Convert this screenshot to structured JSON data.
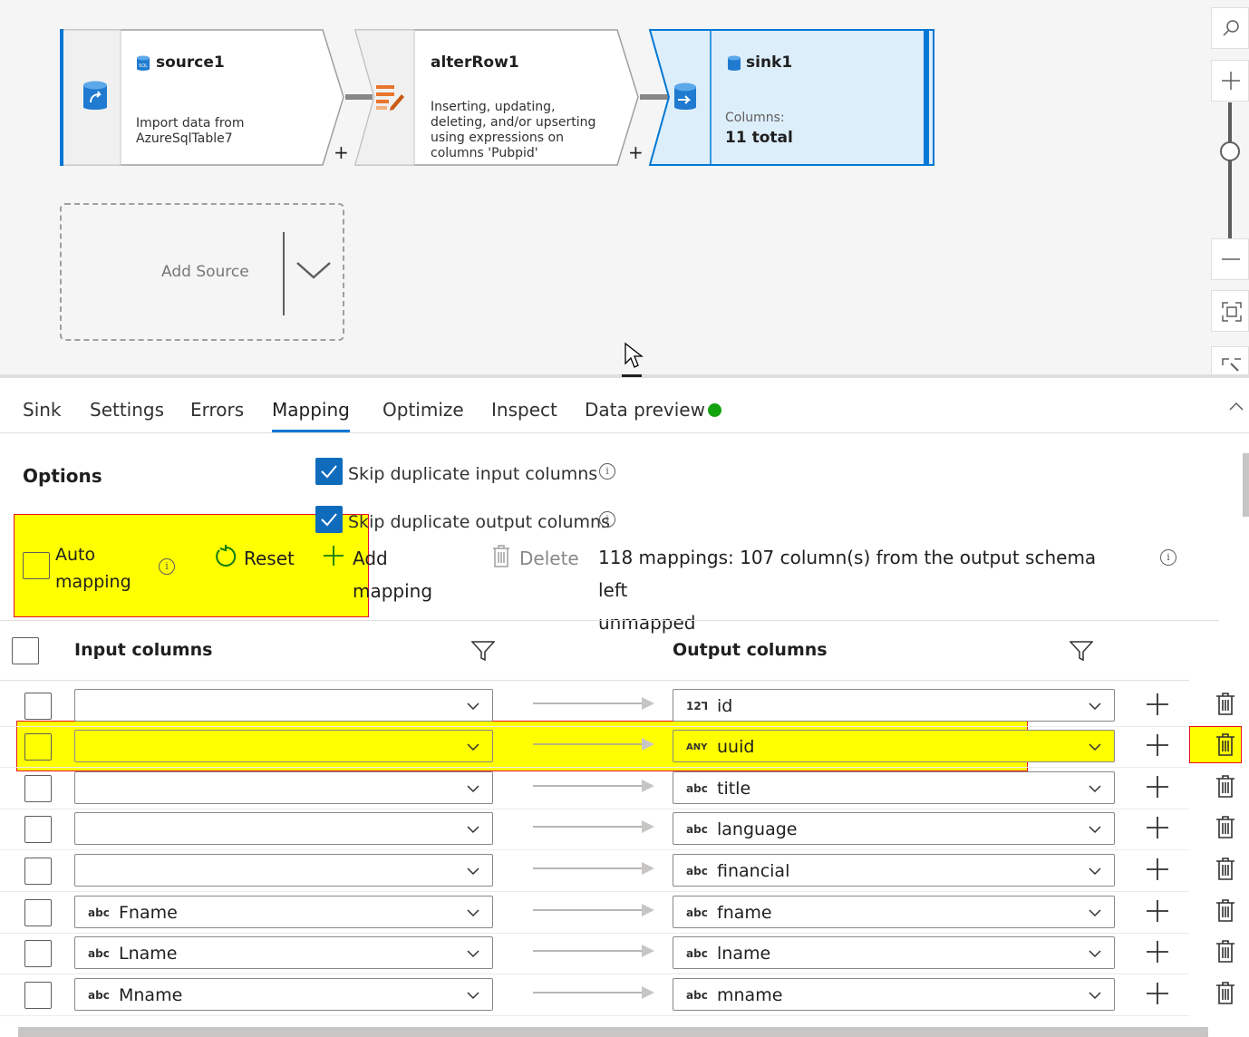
{
  "flow": {
    "nodes": [
      {
        "title": "source1",
        "description": "Import data from AzureSqlTable7",
        "icon": "sql-database-icon"
      },
      {
        "title": "alterRow1",
        "description": "Inserting, updating, deleting, and/or upserting using expressions on columns 'Pubpid'",
        "icon": "alter-row-icon"
      },
      {
        "title": "sink1",
        "columns_label": "Columns:",
        "columns_value": "11 total",
        "icon": "sql-database-icon"
      }
    ],
    "add_plus": "+",
    "add_source_label": "Add Source"
  },
  "zoom": {
    "icons": [
      "search-icon",
      "zoom-in-icon",
      "zoom-out-icon",
      "fit-to-screen-icon",
      "auto-align-icon"
    ],
    "level": 0.6
  },
  "tabs": {
    "items": [
      "Sink",
      "Settings",
      "Errors",
      "Mapping",
      "Optimize",
      "Inspect",
      "Data preview"
    ],
    "active": "Mapping",
    "status_color": "#13a10e"
  },
  "options": {
    "title": "Options",
    "skip_input": "Skip duplicate input columns",
    "skip_output": "Skip duplicate output columns",
    "auto_mapping_line1": "Auto",
    "auto_mapping_line2": "mapping",
    "reset": "Reset",
    "add_mapping_line1": "Add",
    "add_mapping_line2": "mapping",
    "delete": "Delete",
    "summary_line1": "118 mappings: 107 column(s) from the output schema left",
    "summary_line2": "unmapped",
    "info_glyph": "i"
  },
  "grid": {
    "input_header": "Input columns",
    "output_header": "Output columns",
    "rows": [
      {
        "in_type": "",
        "in_value": "",
        "out_type": "12⅂",
        "out_value": "id"
      },
      {
        "in_type": "",
        "in_value": "",
        "out_type": "ANY",
        "out_value": "uuid"
      },
      {
        "in_type": "",
        "in_value": "",
        "out_type": "abc",
        "out_value": "title"
      },
      {
        "in_type": "",
        "in_value": "",
        "out_type": "abc",
        "out_value": "language"
      },
      {
        "in_type": "",
        "in_value": "",
        "out_type": "abc",
        "out_value": "financial"
      },
      {
        "in_type": "abc",
        "in_value": "Fname",
        "out_type": "abc",
        "out_value": "fname"
      },
      {
        "in_type": "abc",
        "in_value": "Lname",
        "out_type": "abc",
        "out_value": "lname"
      },
      {
        "in_type": "abc",
        "in_value": "Mname",
        "out_type": "abc",
        "out_value": "mname"
      }
    ]
  },
  "colors": {
    "accent": "#0078d4",
    "highlight": "#ffff00",
    "highlight_border": "#e81123",
    "sink_fill": "#ddeefb"
  }
}
